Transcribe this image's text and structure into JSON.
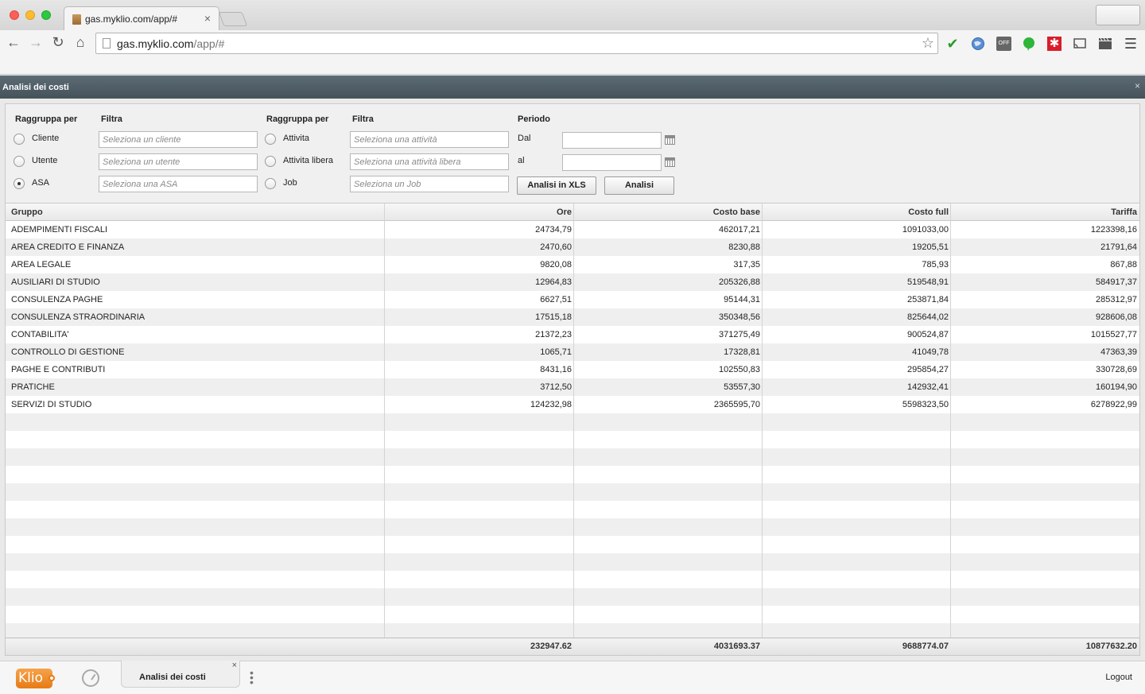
{
  "browser": {
    "tab_title": "gas.myklio.com/app/#",
    "tab_close": "×",
    "url_host": "gas.myklio.com",
    "url_path": "/app/#",
    "ext_off_label": "OFF"
  },
  "app": {
    "window_title": "Analisi dei costi",
    "close_glyph": "×"
  },
  "filters": {
    "group1": {
      "header_group": "Raggruppa per",
      "header_filter": "Filtra",
      "options": [
        {
          "label": "Cliente",
          "placeholder": "Seleziona un cliente",
          "checked": false
        },
        {
          "label": "Utente",
          "placeholder": "Seleziona un utente",
          "checked": false
        },
        {
          "label": "ASA",
          "placeholder": "Seleziona una ASA",
          "checked": true
        }
      ]
    },
    "group2": {
      "header_group": "Raggruppa per",
      "header_filter": "Filtra",
      "options": [
        {
          "label": "Attivita",
          "placeholder": "Seleziona una attività",
          "checked": false
        },
        {
          "label": "Attivita libera",
          "placeholder": "Seleziona una attività libera",
          "checked": false
        },
        {
          "label": "Job",
          "placeholder": "Seleziona un Job",
          "checked": false
        }
      ]
    },
    "period": {
      "header": "Periodo",
      "from_label": "Dal",
      "to_label": "al",
      "from_value": "",
      "to_value": ""
    },
    "buttons": {
      "xls": "Analisi in XLS",
      "analyze": "Analisi"
    }
  },
  "grid": {
    "columns": [
      "Gruppo",
      "Ore",
      "Costo base",
      "Costo full",
      "Tariffa"
    ],
    "rows": [
      [
        "ADEMPIMENTI FISCALI",
        "24734,79",
        "462017,21",
        "1091033,00",
        "1223398,16"
      ],
      [
        "AREA CREDITO E FINANZA",
        "2470,60",
        "8230,88",
        "19205,51",
        "21791,64"
      ],
      [
        "AREA LEGALE",
        "9820,08",
        "317,35",
        "785,93",
        "867,88"
      ],
      [
        "AUSILIARI DI STUDIO",
        "12964,83",
        "205326,88",
        "519548,91",
        "584917,37"
      ],
      [
        "CONSULENZA PAGHE",
        "6627,51",
        "95144,31",
        "253871,84",
        "285312,97"
      ],
      [
        "CONSULENZA STRAORDINARIA",
        "17515,18",
        "350348,56",
        "825644,02",
        "928606,08"
      ],
      [
        "CONTABILITA'",
        "21372,23",
        "371275,49",
        "900524,87",
        "1015527,77"
      ],
      [
        "CONTROLLO DI GESTIONE",
        "1065,71",
        "17328,81",
        "41049,78",
        "47363,39"
      ],
      [
        "PAGHE E CONTRIBUTI",
        "8431,16",
        "102550,83",
        "295854,27",
        "330728,69"
      ],
      [
        "PRATICHE",
        "3712,50",
        "53557,30",
        "142932,41",
        "160194,90"
      ],
      [
        "SERVIZI DI STUDIO",
        "124232,98",
        "2365595,70",
        "5598323,50",
        "6278922,99"
      ]
    ],
    "totals": [
      "",
      "232947.62",
      "4031693.37",
      "9688774.07",
      "10877632.20"
    ]
  },
  "bottombar": {
    "logo_text": "Klio",
    "open_tab": "Analisi dei costi",
    "tab_close": "×",
    "logout": "Logout"
  },
  "colors": {
    "header_bar": "#4f5d66",
    "logo_orange": "#ee8a22"
  }
}
